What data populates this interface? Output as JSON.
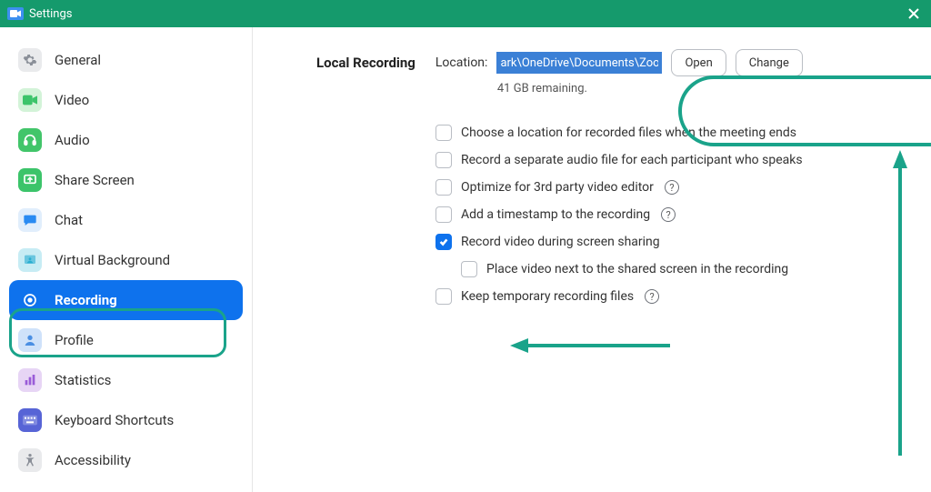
{
  "window": {
    "title": "Settings"
  },
  "sidebar": {
    "items": [
      {
        "label": "General",
        "icon": "gear",
        "bg": "#e9eaec",
        "fg": "#8a8f98"
      },
      {
        "label": "Video",
        "icon": "video",
        "bg": "#d3f3d8",
        "fg": "#3cc46a"
      },
      {
        "label": "Audio",
        "icon": "headphones",
        "bg": "#42c56a",
        "fg": "#ffffff"
      },
      {
        "label": "Share Screen",
        "icon": "share",
        "bg": "#3cc46a",
        "fg": "#ffffff"
      },
      {
        "label": "Chat",
        "icon": "chat",
        "bg": "#e1eefc",
        "fg": "#2a8bf2"
      },
      {
        "label": "Virtual Background",
        "icon": "vbg",
        "bg": "#c7ecf4",
        "fg": "#2aaed1"
      },
      {
        "label": "Recording",
        "icon": "record",
        "bg": "#ffffff",
        "fg": "#ffffff",
        "active": true
      },
      {
        "label": "Profile",
        "icon": "profile",
        "bg": "#cfe2fa",
        "fg": "#4a8fe3"
      },
      {
        "label": "Statistics",
        "icon": "stats",
        "bg": "#e7d5f5",
        "fg": "#9a5cd8"
      },
      {
        "label": "Keyboard Shortcuts",
        "icon": "keyboard",
        "bg": "#5764d6",
        "fg": "#ffffff"
      },
      {
        "label": "Accessibility",
        "icon": "access",
        "bg": "#e9eaec",
        "fg": "#8a8f98"
      }
    ]
  },
  "main": {
    "section_heading": "Local Recording",
    "location_label": "Location:",
    "location_value": "ark\\OneDrive\\Documents\\Zoom",
    "open_btn": "Open",
    "change_btn": "Change",
    "remaining": "41 GB remaining.",
    "options": [
      {
        "label": "Choose a location for recorded files when the meeting ends",
        "checked": false,
        "help": false
      },
      {
        "label": "Record a separate audio file for each participant who speaks",
        "checked": false,
        "help": false
      },
      {
        "label": "Optimize for 3rd party video editor",
        "checked": false,
        "help": true
      },
      {
        "label": "Add a timestamp to the recording",
        "checked": false,
        "help": true
      },
      {
        "label": "Record video during screen sharing",
        "checked": true,
        "help": false
      },
      {
        "label": "Place video next to the shared screen in the recording",
        "checked": false,
        "help": false,
        "sub": true
      },
      {
        "label": "Keep temporary recording files",
        "checked": false,
        "help": true
      }
    ]
  },
  "annotations": {
    "ring_color": "#1aa38a",
    "arrow_color": "#1aa38a"
  }
}
